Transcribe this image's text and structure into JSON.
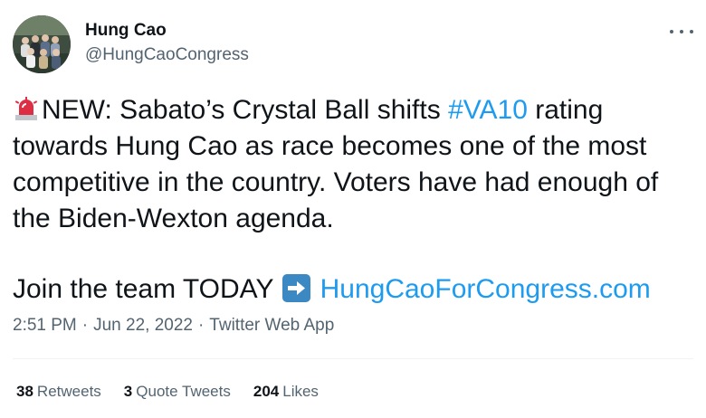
{
  "author": {
    "name": "Hung Cao",
    "handle": "@HungCaoCongress"
  },
  "tweet": {
    "siren_icon": "police-car-light-icon",
    "line1_pre": "NEW: Sabato’s Crystal Ball shifts ",
    "hashtag": "#VA10",
    "line1_post": " rating",
    "line2": "towards Hung Cao as race becomes one of the most",
    "line3": "competitive in the country. Voters have had enough of",
    "line4": "the Biden-Wexton agenda.",
    "line5_pre": "Join the team TODAY ",
    "arrow_icon": "right-arrow-icon",
    "link": "HungCaoForCongress.com"
  },
  "meta": {
    "time": "2:51 PM",
    "separator": "·",
    "date": "Jun 22, 2022",
    "source": "Twitter Web App"
  },
  "stats": {
    "retweets_count": "38",
    "retweets_label": "Retweets",
    "quotes_count": "3",
    "quotes_label": "Quote Tweets",
    "likes_count": "204",
    "likes_label": "Likes"
  },
  "colors": {
    "link": "#1d9bf0",
    "text": "#0f1419",
    "secondary": "#536471",
    "divider": "#eff3f4"
  }
}
